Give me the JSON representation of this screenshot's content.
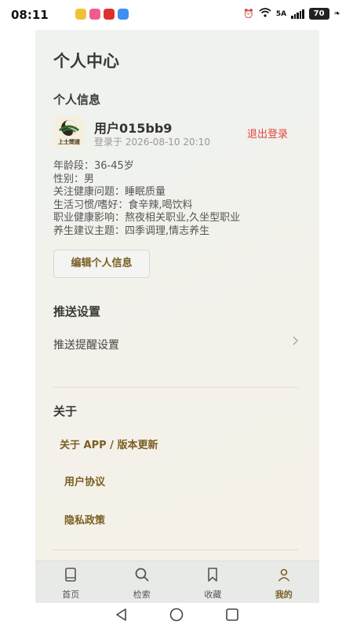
{
  "status_bar": {
    "time": "08:11",
    "network": "5A",
    "battery": "70"
  },
  "page": {
    "title": "个人中心"
  },
  "profile": {
    "section_title": "个人信息",
    "username": "用户015bb9",
    "login_time": "登录于 2026-08-10 20:10",
    "logout_label": "退出登录",
    "avatar_text": "上士問道",
    "info": [
      "年龄段：36-45岁",
      "性别：男",
      "关注健康问题：睡眠质量",
      "生活习惯/嗜好：食辛辣,喝饮料",
      "职业健康影响：熬夜相关职业,久坐型职业",
      "养生建议主题：四季调理,情志养生"
    ],
    "edit_button": "编辑个人信息"
  },
  "push": {
    "section_title": "推送设置",
    "reminder_label": "推送提醒设置"
  },
  "about": {
    "section_title": "关于",
    "links": [
      "关于 APP / 版本更新",
      "用户协议",
      "隐私政策"
    ]
  },
  "tabbar": {
    "tabs": [
      {
        "label": "首页",
        "icon": "book-icon",
        "active": false
      },
      {
        "label": "检索",
        "icon": "search-icon",
        "active": false
      },
      {
        "label": "收藏",
        "icon": "bookmark-icon",
        "active": false
      },
      {
        "label": "我的",
        "icon": "user-icon",
        "active": true
      }
    ]
  },
  "colors": {
    "accent": "#7a5e22",
    "logout": "#e0463a"
  }
}
